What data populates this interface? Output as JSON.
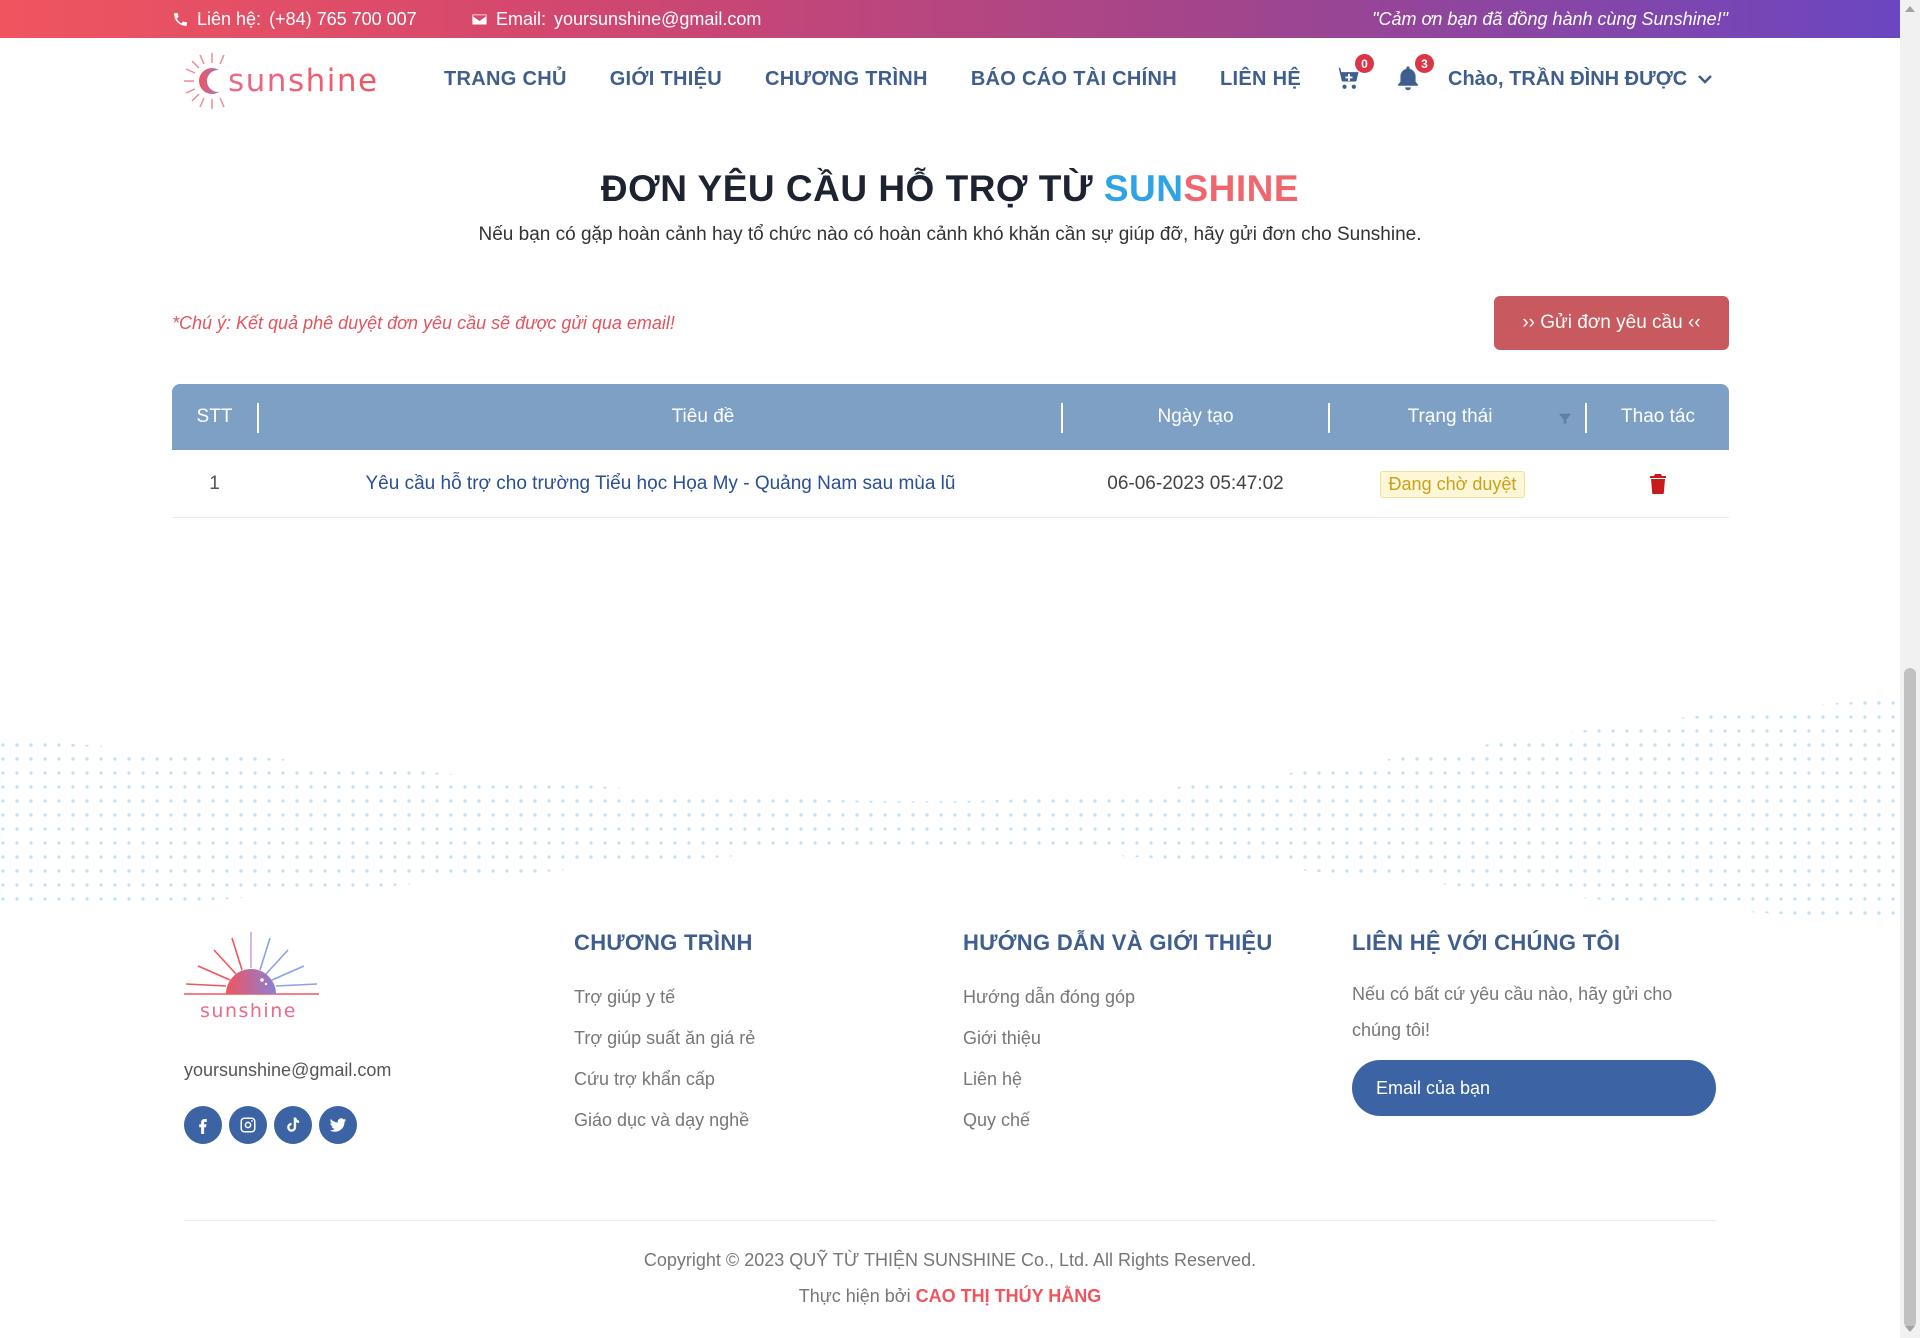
{
  "topbar": {
    "phone_label": "Liên hệ:",
    "phone": "(+84) 765 700 007",
    "email_label": "Email:",
    "email": "yoursunshine@gmail.com",
    "quote": "\"Cảm ơn bạn đã đồng hành cùng Sunshine!\"",
    "icons": [
      "phone-icon",
      "envelope-icon"
    ]
  },
  "header": {
    "logo_text": "sunshine",
    "nav": [
      {
        "label": "TRANG CHỦ"
      },
      {
        "label": "GIỚI THIỆU"
      },
      {
        "label": "CHƯƠNG TRÌNH"
      },
      {
        "label": "BÁO CÁO TÀI CHÍNH"
      },
      {
        "label": "LIÊN HỆ"
      }
    ],
    "cart_count": "0",
    "notification_count": "3",
    "greeting": "Chào, TRẦN ĐÌNH ĐƯỢC"
  },
  "main": {
    "title_prefix": "ĐƠN YÊU CẦU HỖ TRỢ TỪ ",
    "title_sun": "SUN",
    "title_shine": "SHINE",
    "subtitle": "Nếu bạn có gặp hoàn cảnh hay tổ chức nào có hoàn cảnh khó khăn cần sự giúp đỡ, hãy gửi đơn cho Sunshine.",
    "note": "*Chú ý: Kết quả phê duyệt đơn yêu cầu sẽ được gửi qua email!",
    "send_button": "›› Gửi đơn yêu cầu ‹‹"
  },
  "table": {
    "columns": [
      "STT",
      "Tiêu đề",
      "Ngày tạo",
      "Trạng thái",
      "Thao tác"
    ],
    "rows": [
      {
        "stt": "1",
        "title": "Yêu cầu hỗ trợ cho trường Tiểu học Họa My - Quảng Nam sau mùa lũ",
        "date": "06-06-2023 05:47:02",
        "status": "Đang chờ duyệt",
        "action_icon": "trash-icon"
      }
    ]
  },
  "footer": {
    "logo_text": "sunshine",
    "email": "yoursunshine@gmail.com",
    "socials": [
      "facebook-icon",
      "instagram-icon",
      "tiktok-icon",
      "twitter-icon"
    ],
    "col1": {
      "title": "CHƯƠNG TRÌNH",
      "items": [
        "Trợ giúp y tế",
        "Trợ giúp suất ăn giá rẻ",
        "Cứu trợ khẩn cấp",
        "Giáo dục và dạy nghề"
      ]
    },
    "col2": {
      "title": "HƯỚNG DẪN VÀ GIỚI THIỆU",
      "items": [
        "Hướng dẫn đóng góp",
        "Giới thiệu",
        "Liên hệ",
        "Quy chế"
      ]
    },
    "col3": {
      "title": "LIÊN HỆ VỚI CHÚNG TÔI",
      "text": "Nếu có bất cứ yêu cầu nào, hãy gửi cho chúng tôi!",
      "email_placeholder": "Email của bạn"
    },
    "copyright": "Copyright © 2023 QUỸ TỪ THIỆN SUNSHINE Co., Ltd. All Rights Reserved.",
    "madeby_prefix": "Thực hiện bởi ",
    "author": "CAO THỊ THÚY HẰNG"
  },
  "colors": {
    "primary": "#3f5e8e",
    "accent_red": "#f0555f",
    "accent_blue": "#2fa3e6",
    "table_header": "#7da0c4",
    "button": "#c85a5f"
  }
}
